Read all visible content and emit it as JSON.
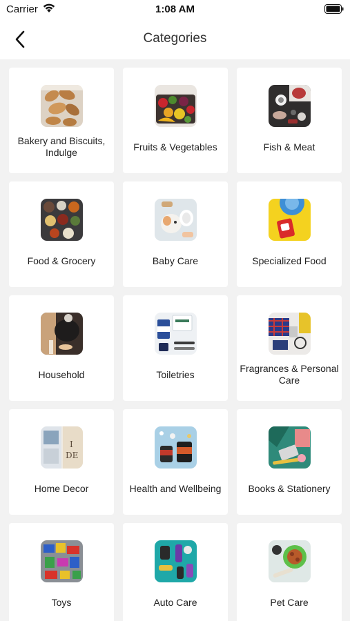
{
  "status_bar": {
    "carrier": "Carrier",
    "time": "1:08 AM"
  },
  "header": {
    "title": "Categories"
  },
  "categories": [
    {
      "label": "Bakery and Biscuits, Indulge",
      "image": "bakery-image"
    },
    {
      "label": "Fruits & Vegetables",
      "image": "fruits-vegetables-image"
    },
    {
      "label": "Fish & Meat",
      "image": "fish-meat-image"
    },
    {
      "label": "Food & Grocery",
      "image": "food-grocery-image"
    },
    {
      "label": "Baby Care",
      "image": "baby-care-image"
    },
    {
      "label": "Specialized Food",
      "image": "specialized-food-image"
    },
    {
      "label": "Household",
      "image": "household-image"
    },
    {
      "label": "Toiletries",
      "image": "toiletries-image"
    },
    {
      "label": "Fragrances & Personal Care",
      "image": "fragrances-image"
    },
    {
      "label": "Home Decor",
      "image": "home-decor-image"
    },
    {
      "label": "Health and Wellbeing",
      "image": "health-image"
    },
    {
      "label": "Books & Stationery",
      "image": "books-image"
    },
    {
      "label": "Toys",
      "image": "toys-image"
    },
    {
      "label": "Auto Care",
      "image": "auto-care-image"
    },
    {
      "label": "Pet Care",
      "image": "pet-care-image"
    }
  ]
}
